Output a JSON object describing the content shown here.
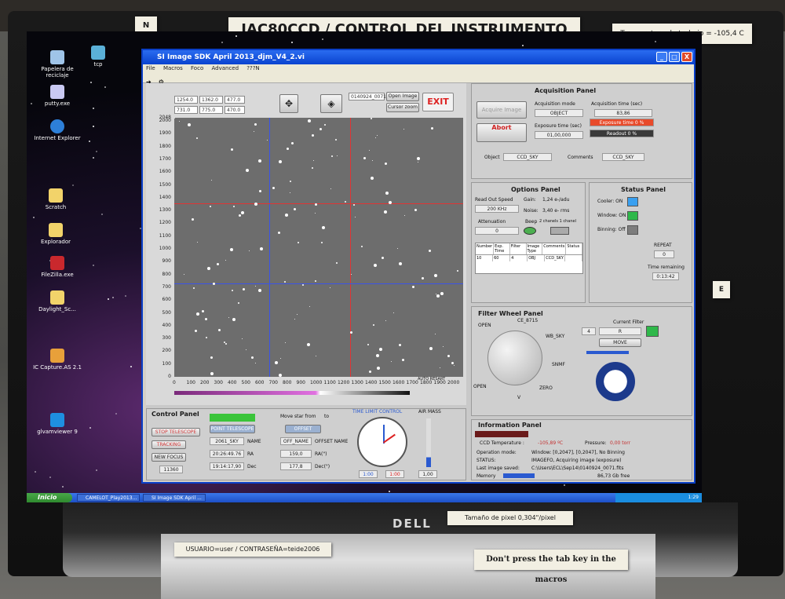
{
  "labels": {
    "title": "IAC80CCD / CONTROL DEL INSTRUMENTO",
    "temperature": "Temperatura de trabajo = -105,4 C",
    "north": "N",
    "east": "E",
    "user": "USUARIO=user / CONTRASEÑA=teide2006",
    "pixel": "Tamaño de pixel 0,304\"/pixel",
    "tab_warning": "Don't press the tab key in the macros",
    "brand": "DELL"
  },
  "desktop": {
    "icons": [
      "Papelera de reciclaje",
      "tcp",
      "putty.exe",
      "Internet Explorer",
      "Scratch",
      "Explorador",
      "FileZilla.exe",
      "Daylight_Sc...",
      "IC Capture.AS 2.1",
      "glvamviewer 9"
    ]
  },
  "window": {
    "title": "SI Image SDK April 2013_djm_V4_2.vi",
    "menu": [
      "File",
      "Macros",
      "Foco",
      "Advanced",
      "???N"
    ],
    "controls": [
      "_",
      "□",
      "X"
    ]
  },
  "viewer": {
    "fields": [
      "1254.0",
      "1362.0",
      "477.0",
      "731.0",
      "775.0",
      "470.0"
    ],
    "file_name": "0140924_0071",
    "open_image": "Open Image ...",
    "cursor_zoom": "Cursor zoom",
    "exit": "EXIT",
    "y_ticks": [
      "2048",
      "2000",
      "1900",
      "1800",
      "1700",
      "1600",
      "1500",
      "1400",
      "1300",
      "1200",
      "1100",
      "1000",
      "900",
      "800",
      "700",
      "600",
      "500",
      "400",
      "300",
      "200",
      "100",
      "0"
    ],
    "x_ticks": [
      "0",
      "100",
      "200",
      "300",
      "400",
      "500",
      "600",
      "700",
      "800",
      "900",
      "1000",
      "1100",
      "1200",
      "1300",
      "1400",
      "1500",
      "1600",
      "1700",
      "1800",
      "1900",
      "2000"
    ],
    "auto_restart": "AUTO RESART",
    "scale_ticks": [
      "10",
      "100",
      "1000",
      "10000"
    ],
    "mode": "W"
  },
  "acquisition": {
    "title": "Acquisition Panel",
    "acquire": "Acquire Image",
    "abort": "Abort",
    "mode_label": "Acquisition mode",
    "mode_value": "OBJECT",
    "time_label": "Acquisition time (sec)",
    "time_value": "83,86",
    "exp_label": "Exposure time (sec)",
    "exp_value": "01,00,000",
    "exp_bar": "Exposure time 0 %",
    "readout_bar": "Readout 0 %",
    "object_label": "Object",
    "object_value": "CCD_SKY",
    "comments_label": "Comments",
    "comments_value": "CCD_SKY"
  },
  "options": {
    "title": "Options Panel",
    "speed_label": "Read Out Speed",
    "speed_value": "200 KHz",
    "gain": "Gain:",
    "gain_value": "1,24 e-/adu",
    "noise": "Noise:",
    "noise_value": "3,40 e- rms",
    "atten_label": "Attenuation",
    "atten_value": "0",
    "beep": "Beep",
    "channels": "2 chanels  1 chanel",
    "columns": [
      "Number",
      "Exp. Time",
      "Filter",
      "Image Type",
      "Comments",
      "Status"
    ],
    "row": [
      "10",
      "60",
      "4",
      "OBJ",
      "CCD_SKY",
      ""
    ]
  },
  "status": {
    "title": "Status Panel",
    "cooler": "Cooler: ON",
    "window": "Window: ON",
    "binning": "Binning: Off",
    "repeat_label": "REPEAT",
    "repeat_value": "0",
    "remaining_label": "Time remaining",
    "remaining_value": "0:13:42",
    "colors": {
      "cooler": "#3aa0f0",
      "window": "#2fb84a",
      "binning": "#7d7d7d"
    }
  },
  "filter_wheel": {
    "title": "Filter Wheel Panel",
    "current_label": "Current Filter",
    "current_number": "4",
    "current_name": "R",
    "move": "MOVE",
    "positions": [
      "OPEN",
      "CE_8715",
      "WB_SKY",
      "SNMF",
      "ZERO",
      "V",
      "OPEN"
    ]
  },
  "info": {
    "title": "Information Panel",
    "ccd_temp": "CCD Temperature :",
    "ccd_temp_value": "-105,89 ºC",
    "pressure": "Pressure:",
    "pressure_value": "0,00 torr",
    "op_mode_label": "Operation mode:",
    "op_mode_value": "Window: [0,2047], [0,2047], No Binning",
    "status_label": "STATUS:",
    "status_value": "IMAGEFO, Acquiring image (exposure)",
    "last_label": "Last image saved:",
    "last_value": "C:\\Users\\ECL\\Sep14\\0140924_0071.fits",
    "memory_label": "Memory",
    "memory_value": "86,73 Gb free"
  },
  "control": {
    "title": "Control Panel",
    "stop_telescope": "STOP TELESCOPE",
    "tracking": "TRACKING",
    "new_focus": "NEW FOCUS",
    "focus_value": "11360",
    "point_telescope": "POINT TELESCOPE",
    "name_value": "2061_SKY",
    "name_label": "NAME",
    "ra_value": "20:26:49.76",
    "ra_label": "RA",
    "dec_value": "19:14:17,90",
    "dec_label": "Dec",
    "move_star": "Move star from",
    "to": "to",
    "offset_btn": "OFFSET",
    "off_name": "OFF_NAME",
    "offset_name": "OFFSET NAME",
    "ra_off": "159,0",
    "ra_off_label": "RA(\")",
    "dec_off": "177,8",
    "dec_off_label": "Dec(\")",
    "time_limit": "TIME LIMIT CONTROL",
    "air_mass": "AIR MASS",
    "am_value": "1,00",
    "clock_a": "1:00",
    "clock_b": "1:00"
  },
  "taskbar": {
    "start": "Inicio",
    "tasks": [
      "CAMELOT_Play2013...",
      "SI Image SDK April ..."
    ],
    "clock": "1:29"
  }
}
